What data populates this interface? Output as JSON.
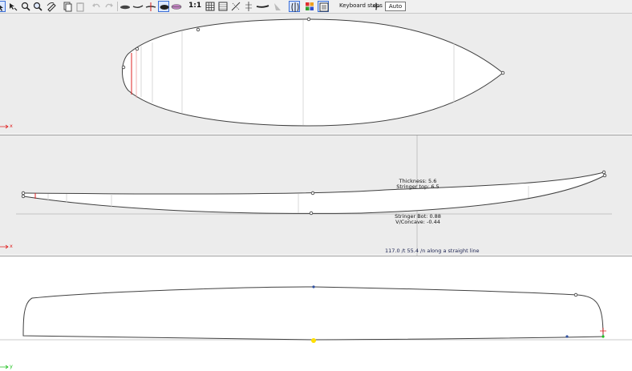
{
  "toolbar": {
    "zoom_label": "1:1",
    "keyboard_steps_label": "Keyboard steps",
    "auto_label": "Auto",
    "icons": [
      "select-icon",
      "pan-icon",
      "zoom-icon",
      "zoom-fit-icon",
      "edit-icon",
      "copy-icon",
      "paste-icon",
      "undo-icon",
      "redo-icon",
      "outline-view-icon",
      "profile-view-icon",
      "cross-section-icon",
      "board-3d-icon",
      "rendered-view-icon",
      "grid-icon",
      "table-icon",
      "measure-icon",
      "center-line-icon",
      "fin-icon",
      "flatten-icon",
      "compare-icon",
      "color-icon",
      "properties-icon",
      "move-icon"
    ]
  },
  "profile_view": {
    "thickness_label": "Thickness: 5.6",
    "stringer_top_label": "Stringer top: 6.5",
    "stringer_bot_label": "Stringer Bot: 0.88",
    "vconcave_label": "V/Concave: -0.44",
    "status_text": "117.0 /t 55.4 /n along a straight line"
  },
  "axes": {
    "x_label": "x",
    "y_label": "y"
  },
  "colors": {
    "panel_bg": "#ececec",
    "outline": "#404040",
    "axis_red": "#e02020",
    "axis_green": "#20c020",
    "control_point": "#3050a0",
    "active_point": "#ffe000"
  }
}
